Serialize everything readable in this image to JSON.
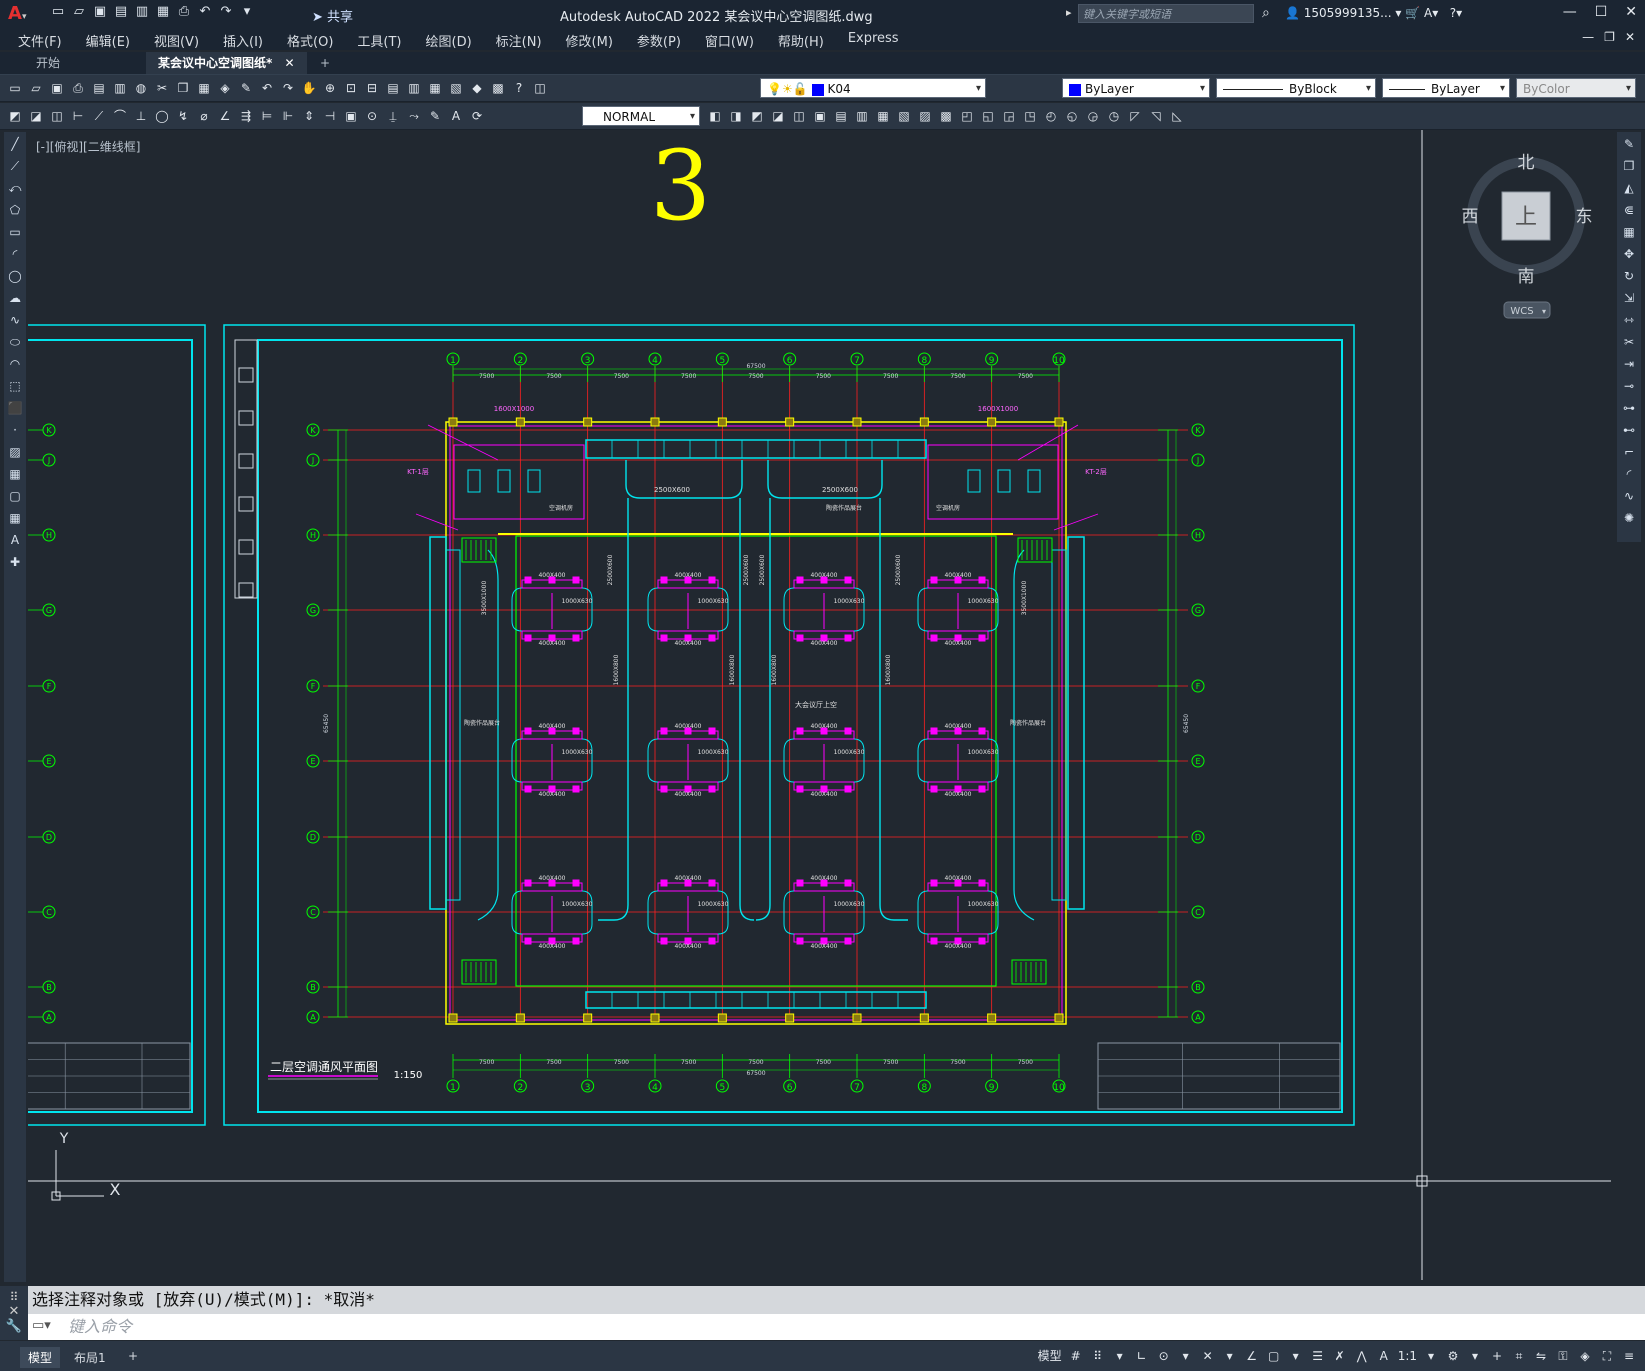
{
  "app": {
    "title": "Autodesk AutoCAD 2022    某会议中心空调图纸.dwg",
    "share_label": "共享",
    "search_placeholder": "键入关键字或短语",
    "user": "1505999135..."
  },
  "menu": [
    "文件(F)",
    "编辑(E)",
    "视图(V)",
    "插入(I)",
    "格式(O)",
    "工具(T)",
    "绘图(D)",
    "标注(N)",
    "修改(M)",
    "参数(P)",
    "窗口(W)",
    "帮助(H)",
    "Express"
  ],
  "tabs": [
    {
      "label": "开始"
    },
    {
      "label": "某会议中心空调图纸*"
    }
  ],
  "toolbars": {
    "layer_value": "K04",
    "color_value": "ByLayer",
    "color_swatch": "#0000ff",
    "linetype_value": "ByBlock",
    "lineweight_value": "ByLayer",
    "plotstyle_value": "ByColor",
    "textstyle_value": "NORMAL"
  },
  "viewport": {
    "label": "[-][俯视][二维线框]",
    "page_number": "3"
  },
  "viewcube": {
    "north": "北",
    "south": "南",
    "east": "东",
    "west": "西",
    "top_face": "上",
    "wcs": "WCS"
  },
  "drawing": {
    "title": "二层空调通风平面图",
    "scale": "1:150",
    "column_labels": [
      "1",
      "2",
      "3",
      "4",
      "5",
      "6",
      "7",
      "8",
      "9",
      "10"
    ],
    "row_labels": [
      "K",
      "J",
      "H",
      "G",
      "F",
      "E",
      "D",
      "C",
      "B",
      "A"
    ],
    "span": "7500",
    "total_width": "67500",
    "total_height": "65450",
    "duct_labels": {
      "top_left": "1600X1000",
      "top_right": "1600X1000",
      "main_left": "2500X600",
      "main_right": "2500X600",
      "side": "3500X1000",
      "branch_a": "400X400",
      "branch_b": "1000X630",
      "trunk": "1600X800"
    },
    "unit_labels": {
      "kt_left": "KT-1层",
      "kt_right": "KT-2层",
      "room_left": "空调机房",
      "room_right": "空调机房",
      "hall": "大会议厅上空",
      "display_left": "陶瓷作品展台",
      "display_right": "陶瓷作品展台",
      "display_top": "陶瓷作品展台"
    }
  },
  "ucs": {
    "y": "Y",
    "x": "X"
  },
  "command": {
    "history": "选择注释对象或 [放弃(U)/模式(M)]: *取消*",
    "placeholder": "键入命令"
  },
  "status": {
    "tabs": [
      "模型",
      "布局1"
    ],
    "model_label": "模型",
    "scale": "1:1"
  },
  "colors": {
    "cyan": "#00e5ee",
    "magenta": "#ff00ff",
    "green": "#00ff00",
    "red": "#ff2020",
    "yellow": "#ffff00"
  }
}
